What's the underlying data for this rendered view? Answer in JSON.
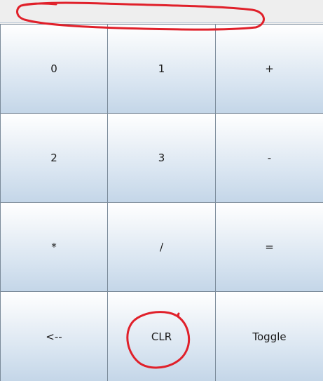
{
  "display": {
    "value": ""
  },
  "keypad": {
    "keys": [
      "0",
      "1",
      "+",
      "2",
      "3",
      "-",
      "*",
      "/",
      "=",
      "<--",
      "CLR",
      "Toggle"
    ]
  },
  "annotations": {
    "color": "#e0202a"
  }
}
